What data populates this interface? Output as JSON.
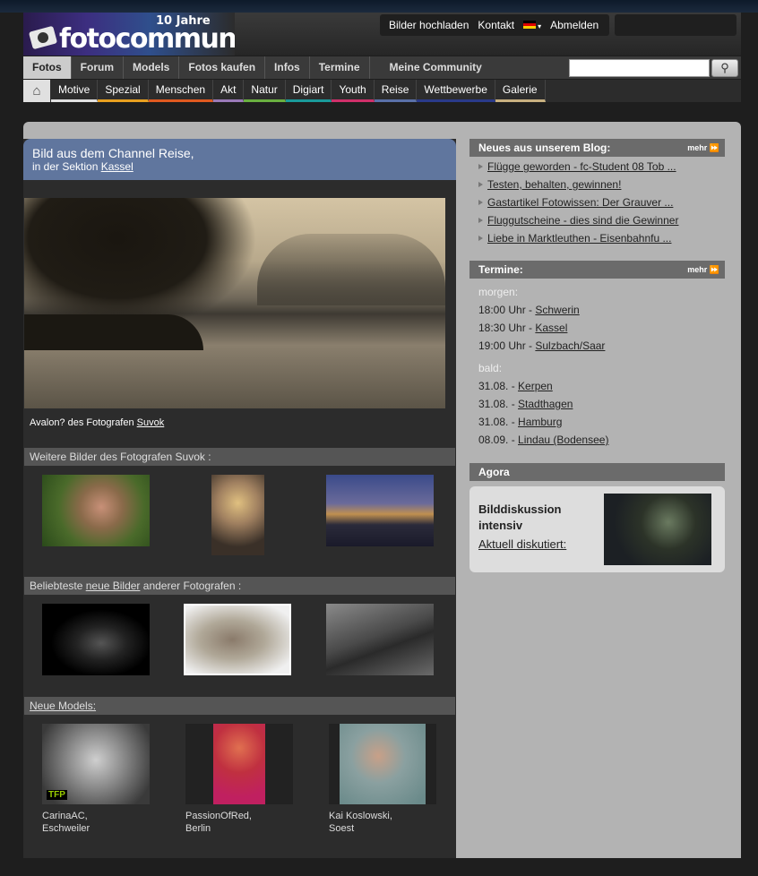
{
  "header": {
    "logo_anniversary": "10 Jahre",
    "logo_text": "fotocommunity",
    "links": [
      "Bilder hochladen",
      "Kontakt",
      "Abmelden"
    ],
    "language_flag": "flag-de-icon"
  },
  "nav_main": {
    "items": [
      "Fotos",
      "Forum",
      "Models",
      "Fotos kaufen",
      "Infos",
      "Termine",
      "Meine Community"
    ],
    "active": "Fotos",
    "search_placeholder": ""
  },
  "nav_categories": {
    "items": [
      {
        "label": "Motive",
        "color": "#e0e0e0"
      },
      {
        "label": "Spezial",
        "color": "#e8a020"
      },
      {
        "label": "Menschen",
        "color": "#e05a20"
      },
      {
        "label": "Akt",
        "color": "#9a7ab8"
      },
      {
        "label": "Natur",
        "color": "#6ab040"
      },
      {
        "label": "Digiart",
        "color": "#1a9a9a"
      },
      {
        "label": "Youth",
        "color": "#d0306a"
      },
      {
        "label": "Reise",
        "color": "#5a70a8"
      },
      {
        "label": "Wettbewerbe",
        "color": "#2a3a8a"
      },
      {
        "label": "Galerie",
        "color": "#c8b080"
      }
    ]
  },
  "channel": {
    "title": "Bild aus dem Channel Reise,",
    "section_prefix": "in der Sektion ",
    "section": "Kassel"
  },
  "main_photo": {
    "caption_prefix": "Avalon? des Fotografen ",
    "photographer": "Suvok"
  },
  "more_by_photographer": {
    "heading": "Weitere Bilder des Fotografen Suvok :"
  },
  "popular_new": {
    "heading_prefix": "Beliebteste ",
    "heading_link": "neue Bilder",
    "heading_suffix": " anderer Fotografen :"
  },
  "new_models": {
    "heading": "Neue Models:",
    "models": [
      {
        "name": "CarinaAC,",
        "city": "Eschweiler",
        "badge": "TFP"
      },
      {
        "name": "PassionOfRed,",
        "city": "Berlin"
      },
      {
        "name": "Kai Koslowski,",
        "city": "Soest"
      }
    ]
  },
  "blog": {
    "heading": "Neues aus unserem Blog:",
    "more": "mehr",
    "items": [
      "Flügge geworden - fc-Student 08 Tob ...",
      "Testen, behalten, gewinnen!",
      "Gastartikel Fotowissen: Der Grauver ...",
      "Fluggutscheine - dies sind die Gewinner",
      "Liebe in Marktleuthen - Eisenbahnfu ..."
    ]
  },
  "termine": {
    "heading": "Termine:",
    "more": "mehr",
    "morgen_label": "morgen:",
    "morgen": [
      {
        "time": "18:00 Uhr - ",
        "place": "Schwerin"
      },
      {
        "time": "18:30 Uhr - ",
        "place": "Kassel"
      },
      {
        "time": "19:00 Uhr - ",
        "place": "Sulzbach/Saar"
      }
    ],
    "bald_label": "bald:",
    "bald": [
      {
        "date": "31.08. - ",
        "place": "Kerpen"
      },
      {
        "date": "31.08. - ",
        "place": "Stadthagen"
      },
      {
        "date": "31.08. - ",
        "place": "Hamburg"
      },
      {
        "date": "08.09. - ",
        "place": "Lindau (Bodensee)"
      }
    ]
  },
  "agora": {
    "heading": "Agora",
    "title": "Bilddiskussion intensiv",
    "link": "Aktuell diskutiert:"
  }
}
